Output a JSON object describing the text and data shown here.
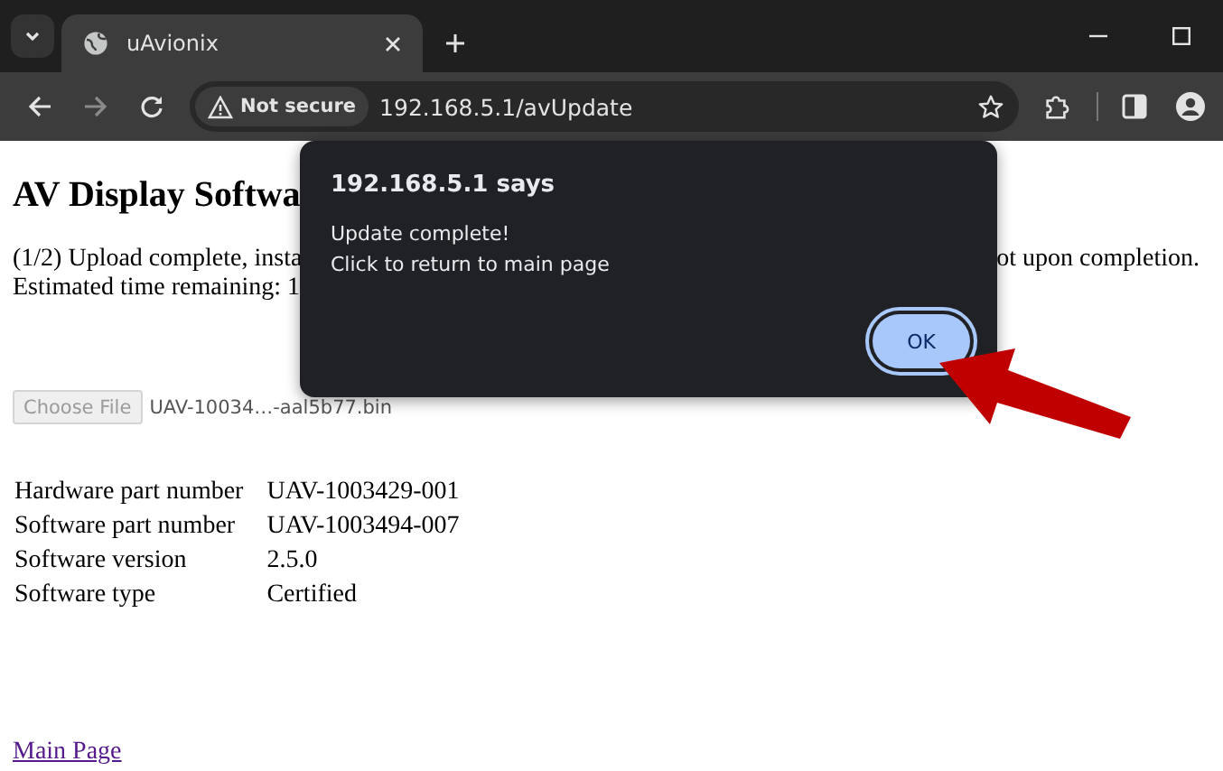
{
  "browser": {
    "tabs": [
      {
        "title": "uAvionix",
        "selected": true
      }
    ],
    "address": {
      "security": "Not secure",
      "url": "192.168.5.1/avUpdate"
    }
  },
  "page": {
    "heading": "AV Display Softwa",
    "status_left": "(1/2) Upload complete, insta",
    "status_right": "ot upon completion.",
    "time_left": "Estimated time remaining: 1",
    "file_button": {
      "label": "Choose File",
      "disabled": true
    },
    "file_name": "UAV-10034…-aal5b77.bin",
    "info": [
      {
        "label": "Hardware part number",
        "value": "UAV-1003429-001"
      },
      {
        "label": "Software part number",
        "value": "UAV-1003494-007"
      },
      {
        "label": "Software version",
        "value": "2.5.0"
      },
      {
        "label": "Software type",
        "value": "Certified"
      }
    ],
    "link": "Main Page"
  },
  "dialog": {
    "title": "192.168.5.1 says",
    "lines": [
      "Update complete!",
      "Click to return to main page"
    ],
    "button": {
      "label": "OK",
      "focused": true
    }
  }
}
